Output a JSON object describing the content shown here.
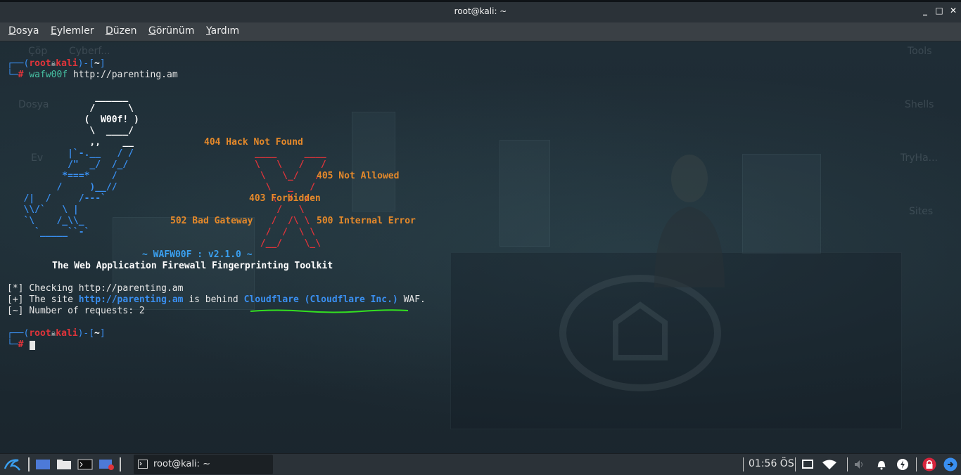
{
  "window": {
    "title": "root@kali: ~",
    "minimize": "_",
    "maximize": "□",
    "close": "✕"
  },
  "menu": {
    "items": [
      "Dosya",
      "Eylemler",
      "Düzen",
      "Görünüm",
      "Yardım"
    ]
  },
  "desktop_labels": [
    "Çöp",
    "Cyberf...",
    "Dosya",
    "Ev",
    "Tools",
    "Shells",
    "TryHa...",
    "Sites"
  ],
  "prompt": {
    "user": "root",
    "skull": "💀",
    "host": "kali",
    "dir": "~",
    "hash": "#"
  },
  "command": {
    "name": "wafw00f",
    "arg": "http://parenting.am"
  },
  "ascii_dog": {
    "line1": "                ______",
    "line2": "               /      \\",
    "line3": "              (  W00f! )",
    "line4": "               \\  ____/",
    "line5": "               ,,    __",
    "line6": "           |`-.__   / /",
    "line7": "           /\"  _/  /_/",
    "line8": "          *===*    /",
    "line9": "         /     )__//",
    "line10": "   /|  /     /---`",
    "line11": "   \\\\/`   \\ |",
    "line12": "   `\\    /_\\\\_",
    "line13": "     `_____``-`"
  },
  "errors": {
    "e404": "404 Hack Not Found",
    "e405": "405 Not Allowed",
    "e403": "403 Forbidden",
    "e502": "502 Bad Gateway",
    "e500": "500 Internal Error"
  },
  "banner": {
    "version": "~ WAFW00F : v2.1.0 ~",
    "tagline": "The Web Application Firewall Fingerprinting Toolkit"
  },
  "output": {
    "check_prefix": "[*]",
    "check_text": "Checking http://parenting.am",
    "found_prefix": "[+]",
    "found_pre": "The site",
    "found_url": "http://parenting.am",
    "found_mid": "is behind",
    "found_waf": "Cloudflare (Cloudflare Inc.)",
    "found_post": "WAF.",
    "req_prefix": "[~]",
    "req_text": "Number of requests: 2"
  },
  "taskbar": {
    "task_label": "root@kali: ~",
    "clock": "01:56 ÖS"
  },
  "colors": {
    "prompt_blue": "#3a8ff0",
    "prompt_red": "#e0343a",
    "error_orange": "#e5892a",
    "highlight_green": "#33e020"
  }
}
